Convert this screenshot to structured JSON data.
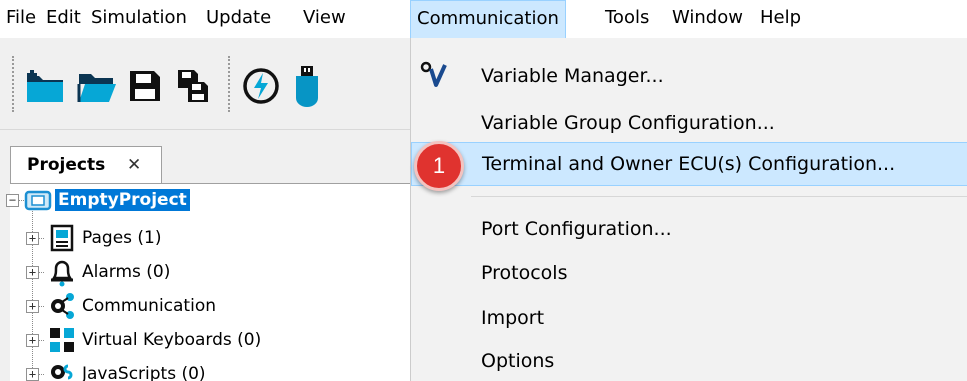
{
  "menubar": {
    "items": [
      {
        "label": "File"
      },
      {
        "label": "Edit"
      },
      {
        "label": "Simulation"
      },
      {
        "label": "Update"
      },
      {
        "label": "View"
      },
      {
        "label": "Communication"
      },
      {
        "label": "Tools"
      },
      {
        "label": "Window"
      },
      {
        "label": "Help"
      }
    ]
  },
  "toolbar": {
    "buttons": [
      {
        "icon": "new-project-icon"
      },
      {
        "icon": "open-folder-icon"
      },
      {
        "icon": "save-icon"
      },
      {
        "icon": "save-all-icon"
      },
      {
        "icon": "connect-icon"
      },
      {
        "icon": "usb-icon"
      }
    ]
  },
  "projects_panel": {
    "tab_title": "Projects",
    "close_glyph": "✕",
    "tree": {
      "root": {
        "label": "EmptyProject",
        "icon": "project-icon"
      },
      "children": [
        {
          "label": "Pages (1)",
          "icon": "pages-icon"
        },
        {
          "label": "Alarms (0)",
          "icon": "alarm-bell-icon"
        },
        {
          "label": "Communication",
          "icon": "communication-icon"
        },
        {
          "label": "Virtual Keyboards (0)",
          "icon": "keyboard-icon"
        },
        {
          "label": "JavaScripts (0)",
          "icon": "javascript-icon"
        }
      ]
    }
  },
  "communication_menu": {
    "items": [
      {
        "label": "Variable Manager...",
        "icon": "variable-manager-icon"
      },
      {
        "label": "Variable Group Configuration..."
      },
      {
        "label": "Terminal and Owner ECU(s) Configuration...",
        "highlighted": true
      },
      {
        "label": "Port Configuration..."
      },
      {
        "label": "Protocols",
        "submenu": true
      },
      {
        "label": "Import",
        "submenu": true
      },
      {
        "label": "Options",
        "submenu": true
      }
    ],
    "submenu_arrow": "›"
  },
  "step_badge": {
    "number": "1",
    "color": "#e0332f"
  },
  "colors": {
    "highlight": "#cce8ff",
    "selection": "#0078d7"
  }
}
